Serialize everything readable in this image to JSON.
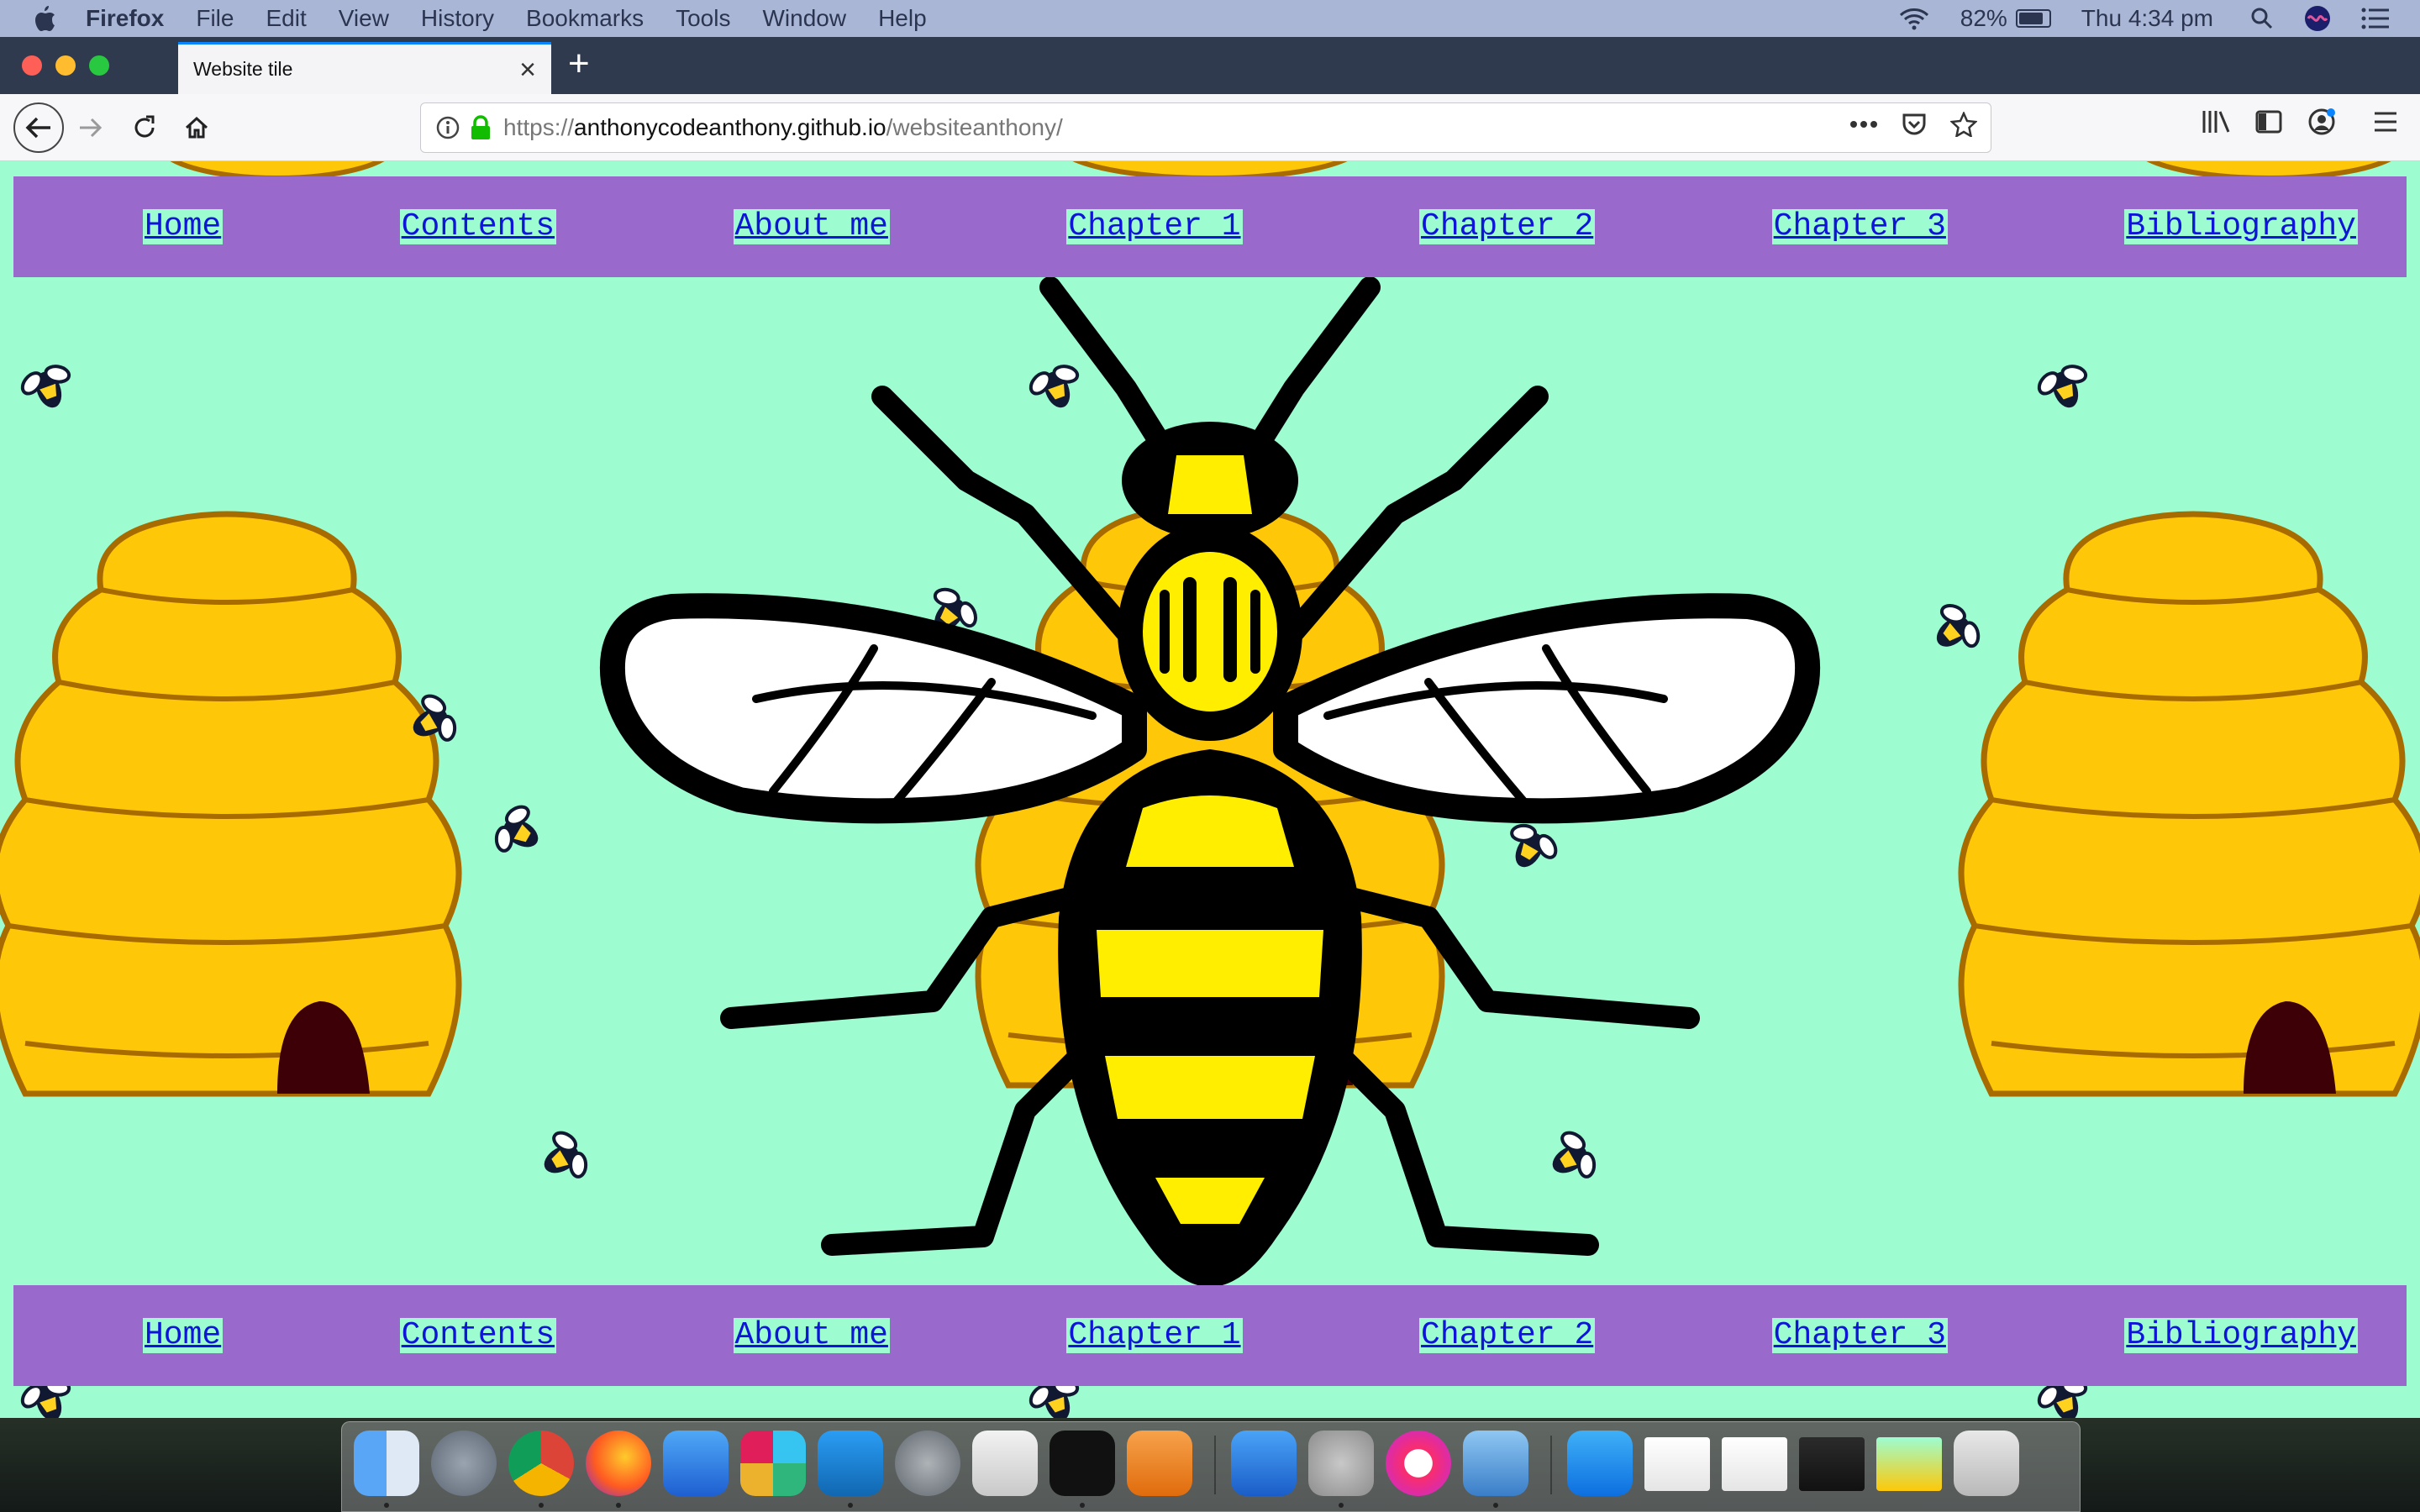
{
  "menubar": {
    "app_name": "Firefox",
    "items": [
      "File",
      "Edit",
      "View",
      "History",
      "Bookmarks",
      "Tools",
      "Window",
      "Help"
    ],
    "battery": "82%",
    "battery_level": 0.82,
    "clock": "Thu 4:34 pm"
  },
  "browser": {
    "tab_title": "Website tile",
    "url_prefix": "https://",
    "url_host": "anthonycodeanthony.github.io",
    "url_path": "/websiteanthony/"
  },
  "site": {
    "nav_top": [
      "Home",
      "Contents",
      "About me",
      "Chapter 1",
      "Chapter 2",
      "Chapter 3",
      "Bibliography"
    ],
    "nav_bottom": [
      "Home",
      "Contents",
      "About me",
      "Chapter 1",
      "Chapter 2",
      "Chapter 3",
      "Bibliography"
    ],
    "colors": {
      "background": "#9dfdd1",
      "nav_band": "#9a69cc",
      "link": "#0e14d8",
      "hive": "#fec808",
      "bee_yellow": "#ffee00"
    }
  },
  "dock": {
    "icons": [
      "finder-icon",
      "launchpad-icon",
      "chrome-icon",
      "firefox-icon",
      "xcode-icon",
      "slack-icon",
      "vscode-icon",
      "system-preferences-icon",
      "screenshot-icon",
      "terminal-icon",
      "pages-icon",
      "keynote-icon",
      "keychain-icon",
      "music-icon",
      "preview-icon",
      "app-store-icon",
      "window-thumb-1",
      "window-thumb-2",
      "window-thumb-3",
      "window-thumb-4",
      "trash-icon"
    ]
  }
}
